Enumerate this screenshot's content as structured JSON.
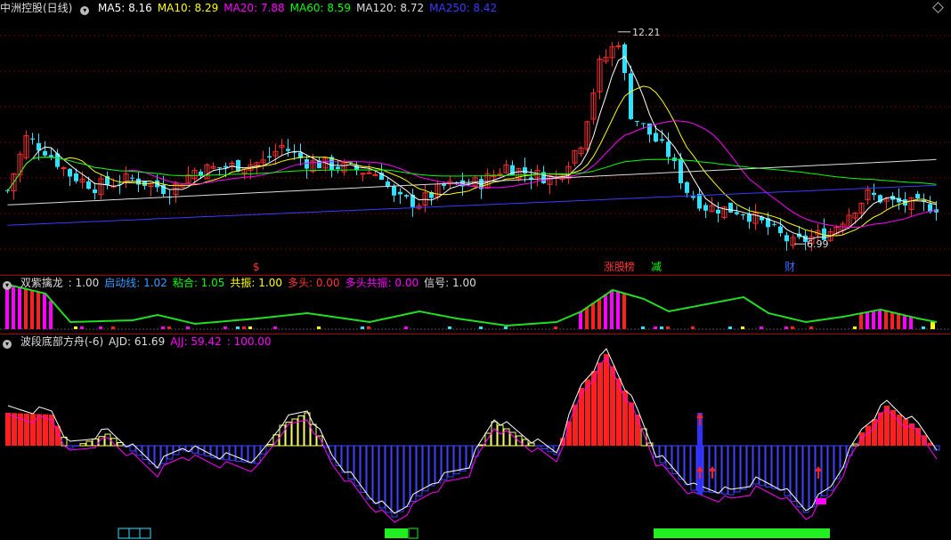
{
  "main": {
    "title": "中洲控股(日线)",
    "ma": [
      {
        "label": "MA5",
        "value": "8.16",
        "color": "#ffffff"
      },
      {
        "label": "MA10",
        "value": "8.29",
        "color": "#ffff00"
      },
      {
        "label": "MA20",
        "value": "7.88",
        "color": "#ff00ff"
      },
      {
        "label": "MA60",
        "value": "8.59",
        "color": "#00ff00"
      },
      {
        "label": "MA120",
        "value": "8.72",
        "color": "#dddddd"
      },
      {
        "label": "MA250",
        "value": "8.42",
        "color": "#3b3bff"
      }
    ],
    "high_marker": "12.21",
    "low_marker": "6.99",
    "markers": [
      {
        "text": "$",
        "color": "#ff3333"
      },
      {
        "text": "涨",
        "color": "#ff3333"
      },
      {
        "text": "股",
        "color": "#ff3333"
      },
      {
        "text": "榜",
        "color": "#ff3333"
      },
      {
        "text": "减",
        "color": "#00ff00"
      },
      {
        "text": "财",
        "color": "#3b6bff"
      }
    ]
  },
  "ind1": {
    "name": "双紫擒龙",
    "values": [
      {
        "label": "",
        "value": "1.00",
        "color": "#dddddd"
      },
      {
        "label": "启动线",
        "value": "1.02",
        "color": "#3b9bff"
      },
      {
        "label": "粘合",
        "value": "1.05",
        "color": "#00ff00"
      },
      {
        "label": "共振",
        "value": "1.00",
        "color": "#ffff00"
      },
      {
        "label": "多头",
        "value": "0.00",
        "color": "#ff3333"
      },
      {
        "label": "多头共振",
        "value": "0.00",
        "color": "#ff00ff"
      },
      {
        "label": "信号",
        "value": "1.00",
        "color": "#dddddd"
      }
    ]
  },
  "ind2": {
    "name": "波段底部方舟(-6)",
    "values": [
      {
        "label": "AJD",
        "value": "61.69",
        "color": "#dddddd"
      },
      {
        "label": "AJJ",
        "value": "59.42",
        "color": "#ff00ff"
      },
      {
        "label": "",
        "value": "100.00",
        "color": "#ff00ff"
      }
    ]
  },
  "colors": {
    "up": "#ff2b2b",
    "down": "#30e0ff",
    "bg": "#000000",
    "grid": "#7a0000"
  },
  "icons": {
    "toggle": "chevron-down-icon",
    "corner": "diamond-icon"
  }
}
